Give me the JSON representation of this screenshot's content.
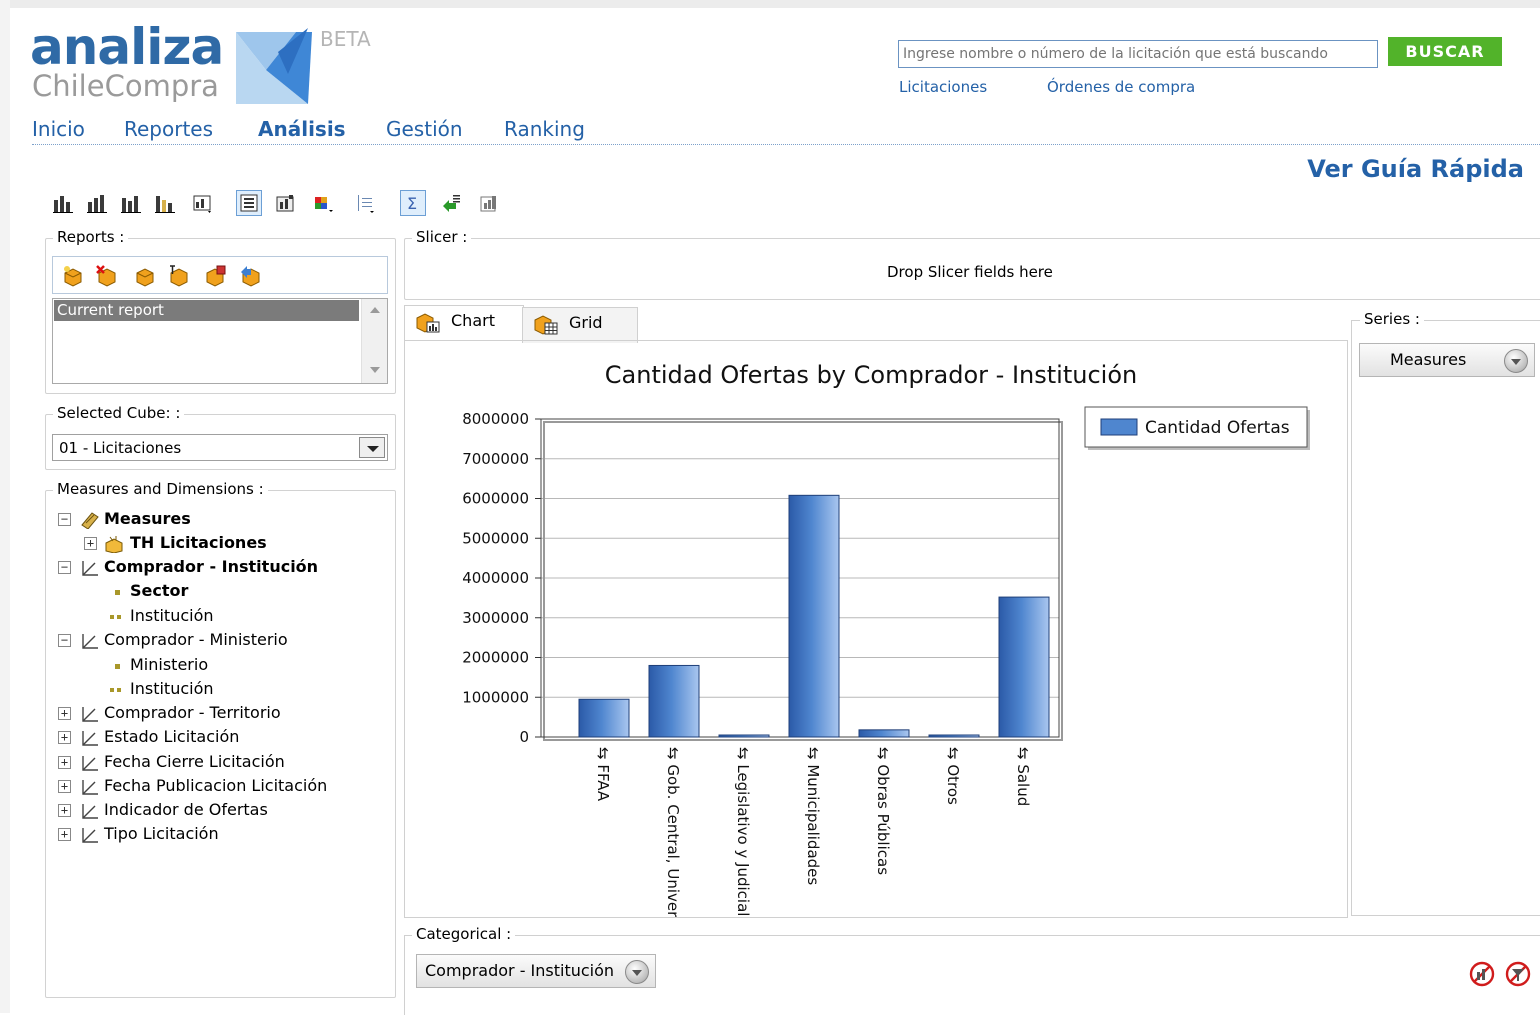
{
  "brand": {
    "name": "analiza",
    "sub": "ChileCompra",
    "beta": "BETA"
  },
  "search": {
    "placeholder": "Ingrese nombre o número de la licitación que está buscando",
    "button": "BUSCAR",
    "links": [
      "Licitaciones",
      "Órdenes de compra"
    ]
  },
  "nav": {
    "items": [
      "Inicio",
      "Reportes",
      "Análisis",
      "Gestión",
      "Ranking"
    ],
    "active": "Análisis"
  },
  "guide_link": "Ver Guía Rápida",
  "left": {
    "reports_label": "Reports :",
    "current_report": "Current report",
    "cube_label": "Selected Cube: :",
    "cube_value": "01 - Licitaciones",
    "measures_label": "Measures and Dimensions :",
    "tree": [
      {
        "label": "Measures",
        "bold": true,
        "toggle": "−",
        "icon": "measures-icon"
      },
      {
        "label": "TH Licitaciones",
        "bold": true,
        "toggle": "+",
        "icon": "cube-icon"
      },
      {
        "label": "Comprador - Institución",
        "bold": true,
        "toggle": "−",
        "icon": "dimension-icon"
      },
      {
        "label": "Sector",
        "bold": true,
        "toggle": "",
        "icon": "level-icon"
      },
      {
        "label": "Institución",
        "bold": false,
        "toggle": "",
        "icon": "level2-icon"
      },
      {
        "label": "Comprador - Ministerio",
        "bold": false,
        "toggle": "−",
        "icon": "dimension-icon"
      },
      {
        "label": "Ministerio",
        "bold": false,
        "toggle": "",
        "icon": "level-icon"
      },
      {
        "label": "Institución",
        "bold": false,
        "toggle": "",
        "icon": "level2-icon"
      },
      {
        "label": "Comprador - Territorio",
        "bold": false,
        "toggle": "+",
        "icon": "dimension-icon"
      },
      {
        "label": "Estado Licitación",
        "bold": false,
        "toggle": "+",
        "icon": "dimension-icon"
      },
      {
        "label": "Fecha Cierre Licitación",
        "bold": false,
        "toggle": "+",
        "icon": "dimension-icon"
      },
      {
        "label": "Fecha Publicacion Licitación",
        "bold": false,
        "toggle": "+",
        "icon": "dimension-icon"
      },
      {
        "label": "Indicador de Ofertas",
        "bold": false,
        "toggle": "+",
        "icon": "dimension-icon"
      },
      {
        "label": "Tipo Licitación",
        "bold": false,
        "toggle": "+",
        "icon": "dimension-icon"
      }
    ]
  },
  "main": {
    "slicer_label": "Slicer :",
    "slicer_drop": "Drop Slicer fields here",
    "tabs": [
      {
        "label": "Chart"
      },
      {
        "label": "Grid"
      }
    ],
    "series_label": "Series :",
    "series_pill": "Measures",
    "categorical_label": "Categorical :",
    "categorical_pill": "Comprador - Institución"
  },
  "chart_data": {
    "type": "bar",
    "title": "Cantidad Ofertas by Comprador - Institución",
    "categories": [
      "FFAA",
      "Gob. Central, Universidades",
      "Legislativo y Judicial",
      "Municipalidades",
      "Obras Públicas",
      "Otros",
      "Salud"
    ],
    "series": [
      {
        "name": "Cantidad Ofertas",
        "values": [
          950000,
          1800000,
          30000,
          6080000,
          180000,
          30000,
          3520000
        ]
      }
    ],
    "ylim": [
      0,
      8000000
    ],
    "yticks": [
      "8000000",
      "7000000",
      "6000000",
      "5000000",
      "4000000",
      "3000000",
      "2000000",
      "1000000",
      "0"
    ],
    "grid": true,
    "legend": "top-right",
    "bar_color": "#4f86cf"
  }
}
